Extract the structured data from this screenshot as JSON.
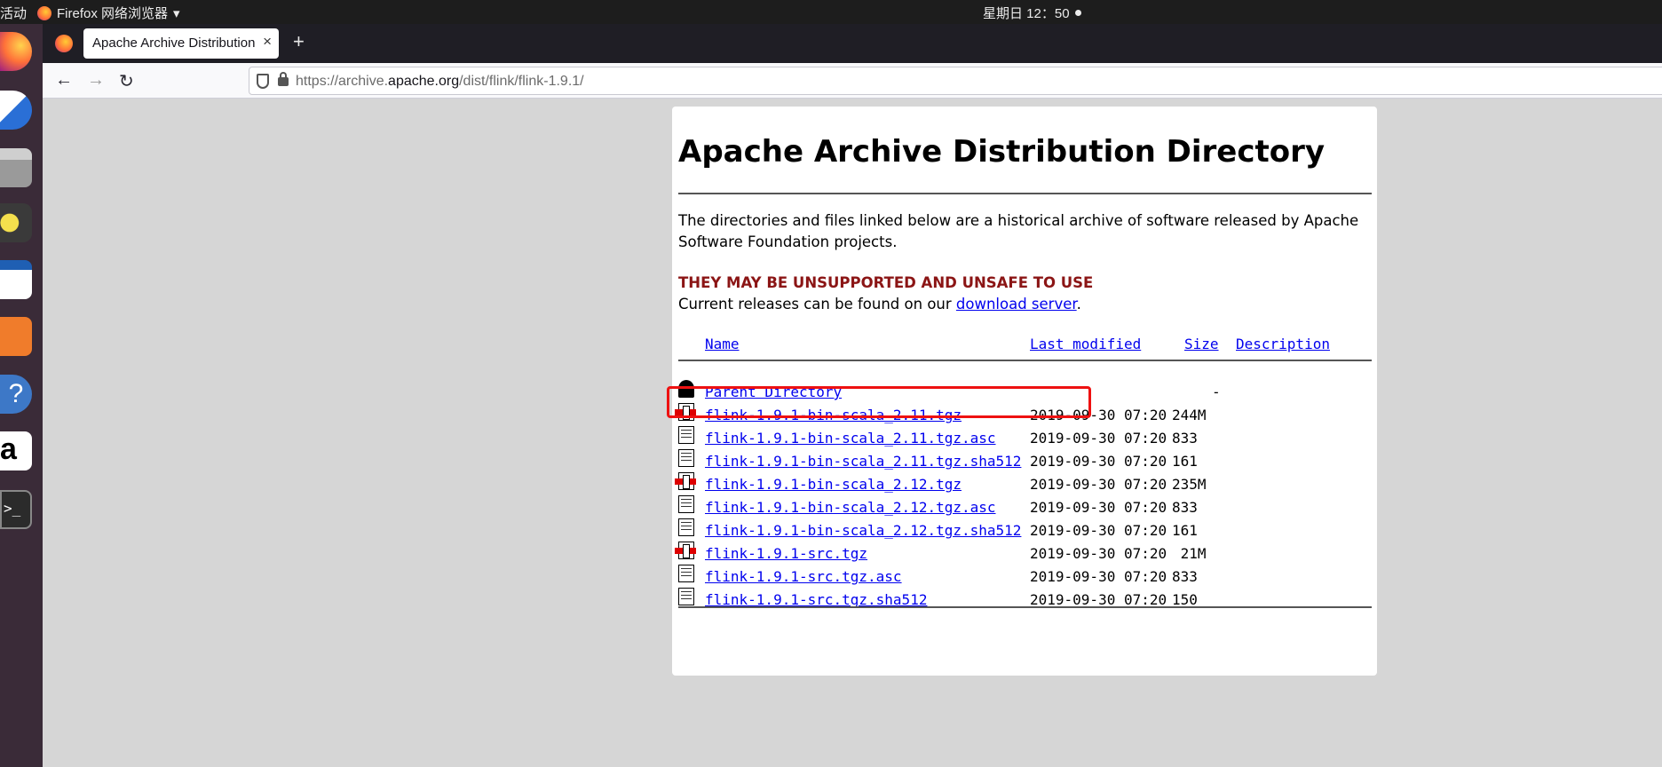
{
  "topbar": {
    "activities": "活动",
    "app_menu": "Firefox 网络浏览器",
    "clock": "星期日 12：50"
  },
  "dock": {
    "items": [
      "firefox-icon",
      "thunderbird-icon",
      "files-icon",
      "rhythmbox-icon",
      "writer-icon",
      "software-icon",
      "help-icon",
      "amazon-icon",
      "terminal-icon"
    ]
  },
  "browser": {
    "tab_title": "Apache Archive Distribution Directory",
    "tab_close": "×",
    "new_tab": "+",
    "url_prefix": "https://archive.",
    "url_domain": "apache.org",
    "url_path": "/dist/flink/flink-1.9.1/"
  },
  "page": {
    "title": "Apache Archive Distribution Directory",
    "intro": "The directories and files linked below are a historical archive of software released by Apache Software Foundation projects.",
    "warning": "THEY MAY BE UNSUPPORTED AND UNSAFE TO USE",
    "current_prefix": "Current releases can be found on our ",
    "current_link": "download server",
    "current_suffix": ".",
    "columns": {
      "name": "Name",
      "modified": "Last modified",
      "size": "Size",
      "description": "Description"
    },
    "parent": {
      "label": "Parent Directory",
      "size": "-"
    },
    "files": [
      {
        "name": "flink-1.9.1-bin-scala_2.11.tgz",
        "date": "2019-09-30 07:20",
        "size": "244M",
        "icon": "compressed-icon"
      },
      {
        "name": "flink-1.9.1-bin-scala_2.11.tgz.asc",
        "date": "2019-09-30 07:20",
        "size": "833",
        "icon": "text-file-icon"
      },
      {
        "name": "flink-1.9.1-bin-scala_2.11.tgz.sha512",
        "date": "2019-09-30 07:20",
        "size": "161",
        "icon": "text-file-icon"
      },
      {
        "name": "flink-1.9.1-bin-scala_2.12.tgz",
        "date": "2019-09-30 07:20",
        "size": "235M",
        "icon": "compressed-icon"
      },
      {
        "name": "flink-1.9.1-bin-scala_2.12.tgz.asc",
        "date": "2019-09-30 07:20",
        "size": "833",
        "icon": "text-file-icon"
      },
      {
        "name": "flink-1.9.1-bin-scala_2.12.tgz.sha512",
        "date": "2019-09-30 07:20",
        "size": "161",
        "icon": "text-file-icon"
      },
      {
        "name": "flink-1.9.1-src.tgz",
        "date": "2019-09-30 07:20",
        "size": " 21M",
        "icon": "compressed-icon"
      },
      {
        "name": "flink-1.9.1-src.tgz.asc",
        "date": "2019-09-30 07:20",
        "size": "833",
        "icon": "text-file-icon"
      },
      {
        "name": "flink-1.9.1-src.tgz.sha512",
        "date": "2019-09-30 07:20",
        "size": "150",
        "icon": "text-file-icon"
      }
    ]
  },
  "colors": {
    "warning": "#8b1515",
    "link": "#0000ee",
    "highlight": "#ee1111"
  }
}
